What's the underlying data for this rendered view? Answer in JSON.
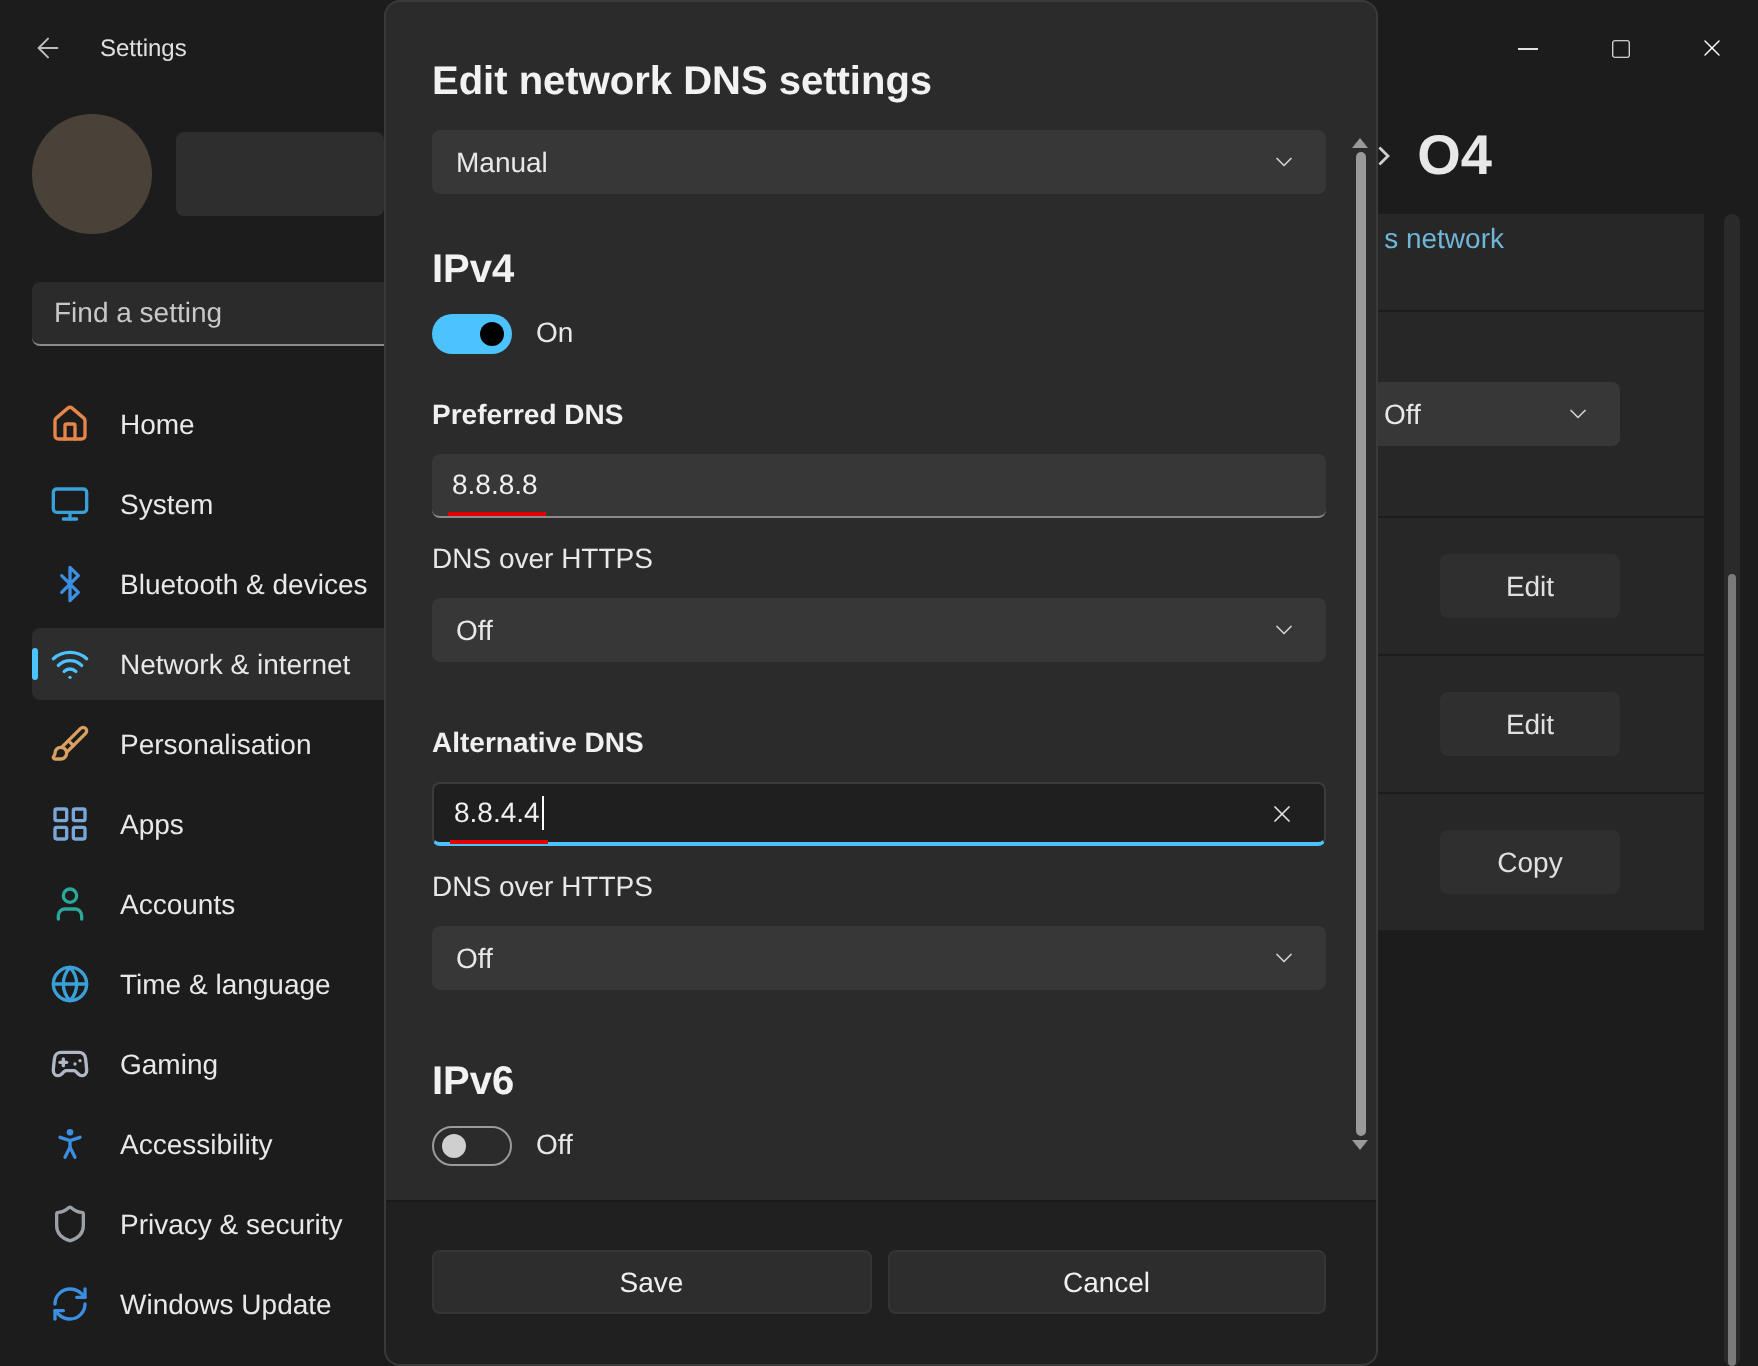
{
  "title_bar": {
    "title": "Settings"
  },
  "sidebar": {
    "search": {
      "placeholder": "Find a setting"
    },
    "items": [
      {
        "label": "Home",
        "selected": false
      },
      {
        "label": "System",
        "selected": false
      },
      {
        "label": "Bluetooth & devices",
        "selected": false
      },
      {
        "label": "Network & internet",
        "selected": true
      },
      {
        "label": "Personalisation",
        "selected": false
      },
      {
        "label": "Apps",
        "selected": false
      },
      {
        "label": "Accounts",
        "selected": false
      },
      {
        "label": "Time & language",
        "selected": false
      },
      {
        "label": "Gaming",
        "selected": false
      },
      {
        "label": "Accessibility",
        "selected": false
      },
      {
        "label": "Privacy & security",
        "selected": false
      },
      {
        "label": "Windows Update",
        "selected": false
      }
    ]
  },
  "page": {
    "title": "O4",
    "link": "s network",
    "rows": [
      {
        "kind": "dropdown",
        "value": "Off"
      },
      {
        "kind": "button",
        "label": "Edit"
      },
      {
        "kind": "button",
        "label": "Edit"
      },
      {
        "kind": "button",
        "label": "Copy"
      }
    ]
  },
  "dialog": {
    "title": "Edit network DNS settings",
    "mode": {
      "value": "Manual"
    },
    "sections": [
      {
        "heading": "IPv4",
        "toggle": {
          "on": true,
          "label": "On"
        },
        "fields": [
          {
            "label": "Preferred DNS",
            "value": "8.8.8.8",
            "focused": false,
            "underlined": true,
            "https_label": "DNS over HTTPS",
            "https_value": "Off"
          },
          {
            "label": "Alternative DNS",
            "value": "8.8.4.4",
            "focused": true,
            "underlined": true,
            "https_label": "DNS over HTTPS",
            "https_value": "Off"
          }
        ]
      },
      {
        "heading": "IPv6",
        "toggle": {
          "on": false,
          "label": "Off"
        }
      }
    ],
    "buttons": [
      {
        "label": "Save"
      },
      {
        "label": "Cancel"
      }
    ]
  }
}
